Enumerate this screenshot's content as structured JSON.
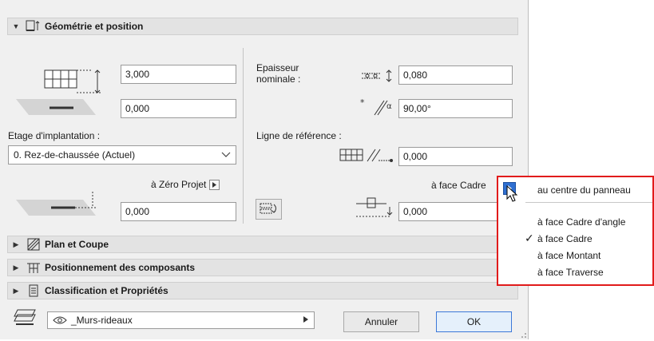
{
  "sections": {
    "geometry": {
      "label": "Géométrie et position"
    },
    "plan": {
      "label": "Plan et Coupe"
    },
    "positioning": {
      "label": "Positionnement des composants"
    },
    "classification": {
      "label": "Classification et Propriétés"
    }
  },
  "geometry": {
    "height_value": "3,000",
    "offset_value": "0,000",
    "story_label": "Etage d'implantation :",
    "story_value": "0. Rez-de-chaussée (Actuel)",
    "zero_label": "à Zéro Projet",
    "zero_value": "0,000",
    "thickness_label_line1": "Epaisseur",
    "thickness_label_line2": "nominale :",
    "thickness_value": "0,080",
    "angle_value": "90,00°",
    "refline_label": "Ligne de référence :",
    "refline_value": "0,000",
    "frame_label": "à face Cadre",
    "frame_value": "0,000"
  },
  "footer": {
    "layer_value": "_Murs-rideaux",
    "cancel_label": "Annuler",
    "ok_label": "OK"
  },
  "popup": {
    "top_item": "au centre du panneau",
    "items": [
      "à face Cadre d'angle",
      "à face Cadre",
      "à face Montant",
      "à face Traverse"
    ],
    "checked_index": 1,
    "check_mark": "✓"
  },
  "colors": {
    "popup_border": "#e11b1b",
    "ok_border": "#3c78d8",
    "accent_blue": "#2f6fd1"
  },
  "icons": [
    "geometry-section-icon",
    "plan-section-icon",
    "components-section-icon",
    "classification-section-icon",
    "wall-height-icon",
    "wall-base-icon",
    "wall-zero-icon",
    "thickness-icon",
    "angle-icon",
    "refline-icon",
    "flip-icon",
    "frame-offset-icon",
    "layer-icon",
    "eye-icon",
    "mouse-cursor-icon"
  ]
}
